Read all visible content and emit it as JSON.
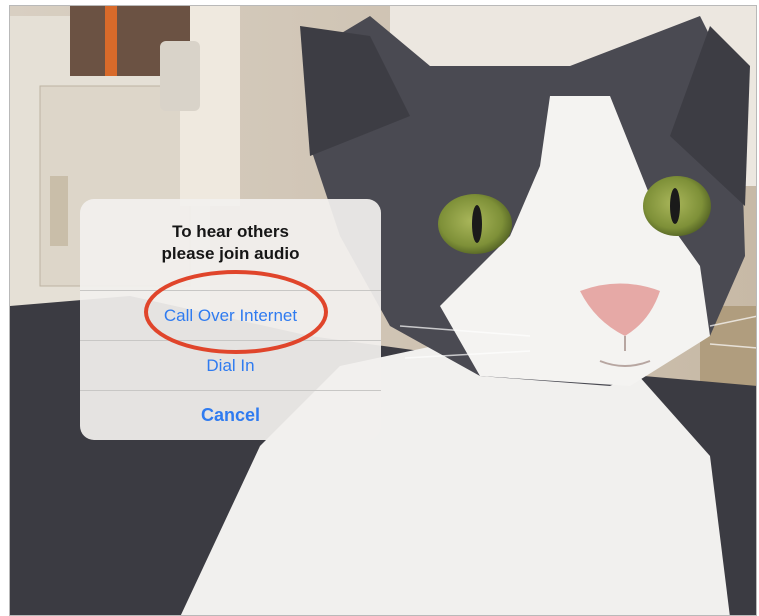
{
  "dialog": {
    "title_line1": "To hear others",
    "title_line2": "please join audio",
    "options": [
      {
        "label": "Call Over Internet"
      },
      {
        "label": "Dial In"
      },
      {
        "label": "Cancel"
      }
    ]
  },
  "colors": {
    "accent": "#2f7bf0",
    "annotation": "#e0452b",
    "sheet_background": "#f2f0ee"
  },
  "icons": [
    "red-ellipse-annotation"
  ]
}
